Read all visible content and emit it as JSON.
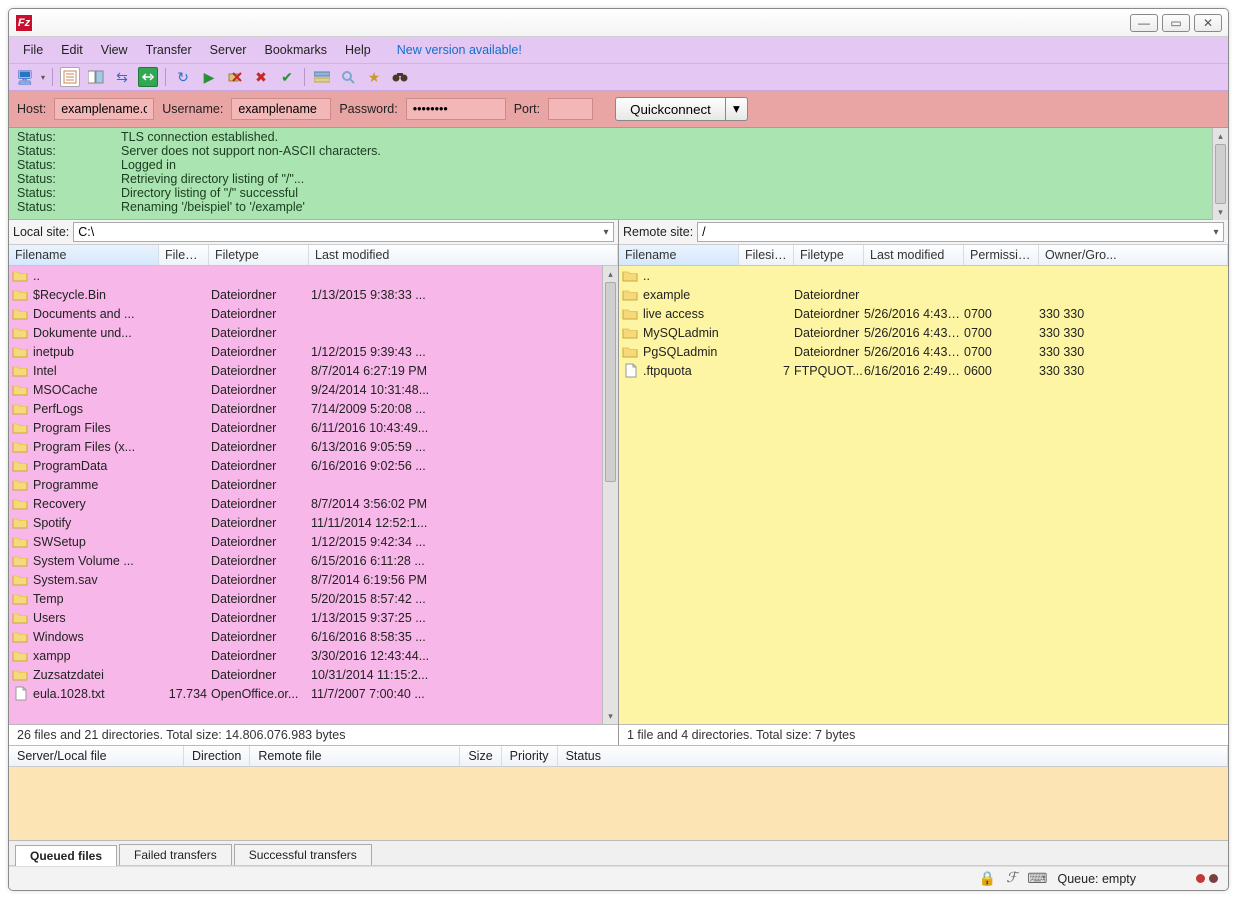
{
  "menus": [
    "File",
    "Edit",
    "View",
    "Transfer",
    "Server",
    "Bookmarks",
    "Help"
  ],
  "update_text": "New version available!",
  "quick": {
    "host_label": "Host:",
    "host": "examplename.com",
    "user_label": "Username:",
    "user": "examplename",
    "pass_label": "Password:",
    "pass": "••••••••",
    "port_label": "Port:",
    "port": "",
    "button": "Quickconnect"
  },
  "log": [
    {
      "k": "Status:",
      "v": "TLS connection established."
    },
    {
      "k": "Status:",
      "v": "Server does not support non-ASCII characters."
    },
    {
      "k": "Status:",
      "v": "Logged in"
    },
    {
      "k": "Status:",
      "v": "Retrieving directory listing of \"/\"..."
    },
    {
      "k": "Status:",
      "v": "Directory listing of \"/\" successful"
    },
    {
      "k": "Status:",
      "v": "Renaming '/beispiel' to '/example'"
    }
  ],
  "local": {
    "label": "Local site:",
    "path": "C:\\",
    "cols": [
      "Filename",
      "Filesize",
      "Filetype",
      "Last modified"
    ],
    "rows": [
      {
        "ic": "up",
        "n": "..",
        "s": "",
        "t": "",
        "m": ""
      },
      {
        "ic": "f",
        "n": "$Recycle.Bin",
        "s": "",
        "t": "Dateiordner",
        "m": "1/13/2015 9:38:33 ..."
      },
      {
        "ic": "f",
        "n": "Documents and ...",
        "s": "",
        "t": "Dateiordner",
        "m": ""
      },
      {
        "ic": "f",
        "n": "Dokumente und...",
        "s": "",
        "t": "Dateiordner",
        "m": ""
      },
      {
        "ic": "f",
        "n": "inetpub",
        "s": "",
        "t": "Dateiordner",
        "m": "1/12/2015 9:39:43 ..."
      },
      {
        "ic": "f",
        "n": "Intel",
        "s": "",
        "t": "Dateiordner",
        "m": "8/7/2014 6:27:19 PM"
      },
      {
        "ic": "f",
        "n": "MSOCache",
        "s": "",
        "t": "Dateiordner",
        "m": "9/24/2014 10:31:48..."
      },
      {
        "ic": "f",
        "n": "PerfLogs",
        "s": "",
        "t": "Dateiordner",
        "m": "7/14/2009 5:20:08 ..."
      },
      {
        "ic": "f",
        "n": "Program Files",
        "s": "",
        "t": "Dateiordner",
        "m": "6/11/2016 10:43:49..."
      },
      {
        "ic": "f",
        "n": "Program Files (x...",
        "s": "",
        "t": "Dateiordner",
        "m": "6/13/2016 9:05:59 ..."
      },
      {
        "ic": "f",
        "n": "ProgramData",
        "s": "",
        "t": "Dateiordner",
        "m": "6/16/2016 9:02:56 ..."
      },
      {
        "ic": "f",
        "n": "Programme",
        "s": "",
        "t": "Dateiordner",
        "m": ""
      },
      {
        "ic": "f",
        "n": "Recovery",
        "s": "",
        "t": "Dateiordner",
        "m": "8/7/2014 3:56:02 PM"
      },
      {
        "ic": "f",
        "n": "Spotify",
        "s": "",
        "t": "Dateiordner",
        "m": "11/11/2014 12:52:1..."
      },
      {
        "ic": "f",
        "n": "SWSetup",
        "s": "",
        "t": "Dateiordner",
        "m": "1/12/2015 9:42:34 ..."
      },
      {
        "ic": "f",
        "n": "System Volume ...",
        "s": "",
        "t": "Dateiordner",
        "m": "6/15/2016 6:11:28 ..."
      },
      {
        "ic": "f",
        "n": "System.sav",
        "s": "",
        "t": "Dateiordner",
        "m": "8/7/2014 6:19:56 PM"
      },
      {
        "ic": "f",
        "n": "Temp",
        "s": "",
        "t": "Dateiordner",
        "m": "5/20/2015 8:57:42 ..."
      },
      {
        "ic": "f",
        "n": "Users",
        "s": "",
        "t": "Dateiordner",
        "m": "1/13/2015 9:37:25 ..."
      },
      {
        "ic": "f",
        "n": "Windows",
        "s": "",
        "t": "Dateiordner",
        "m": "6/16/2016 8:58:35 ..."
      },
      {
        "ic": "f",
        "n": "xampp",
        "s": "",
        "t": "Dateiordner",
        "m": "3/30/2016 12:43:44..."
      },
      {
        "ic": "f",
        "n": "Zuzsatzdatei",
        "s": "",
        "t": "Dateiordner",
        "m": "10/31/2014 11:15:2..."
      },
      {
        "ic": "d",
        "n": "eula.1028.txt",
        "s": "17.734",
        "t": "OpenOffice.or...",
        "m": "11/7/2007 7:00:40 ..."
      }
    ],
    "summary": "26 files and 21 directories. Total size: 14.806.076.983 bytes"
  },
  "remote": {
    "label": "Remote site:",
    "path": "/",
    "cols": [
      "Filename",
      "Filesize",
      "Filetype",
      "Last modified",
      "Permissions",
      "Owner/Gro..."
    ],
    "rows": [
      {
        "ic": "up",
        "n": "..",
        "s": "",
        "t": "",
        "m": "",
        "p": "",
        "o": ""
      },
      {
        "ic": "f",
        "n": "example",
        "s": "",
        "t": "Dateiordner",
        "m": "",
        "p": "",
        "o": ""
      },
      {
        "ic": "f",
        "n": "live access",
        "s": "",
        "t": "Dateiordner",
        "m": "5/26/2016 4:43:...",
        "p": "0700",
        "o": "330 330"
      },
      {
        "ic": "f",
        "n": "MySQLadmin",
        "s": "",
        "t": "Dateiordner",
        "m": "5/26/2016 4:43:...",
        "p": "0700",
        "o": "330 330"
      },
      {
        "ic": "f",
        "n": "PgSQLadmin",
        "s": "",
        "t": "Dateiordner",
        "m": "5/26/2016 4:43:...",
        "p": "0700",
        "o": "330 330"
      },
      {
        "ic": "d",
        "n": ".ftpquota",
        "s": "7",
        "t": "FTPQUOT...",
        "m": "6/16/2016 2:49:...",
        "p": "0600",
        "o": "330 330"
      }
    ],
    "summary": "1 file and 4 directories. Total size: 7 bytes"
  },
  "queue_cols": [
    "Server/Local file",
    "Direction",
    "Remote file",
    "Size",
    "Priority",
    "Status"
  ],
  "tabs": [
    "Queued files",
    "Failed transfers",
    "Successful transfers"
  ],
  "status": {
    "queue": "Queue: empty"
  }
}
